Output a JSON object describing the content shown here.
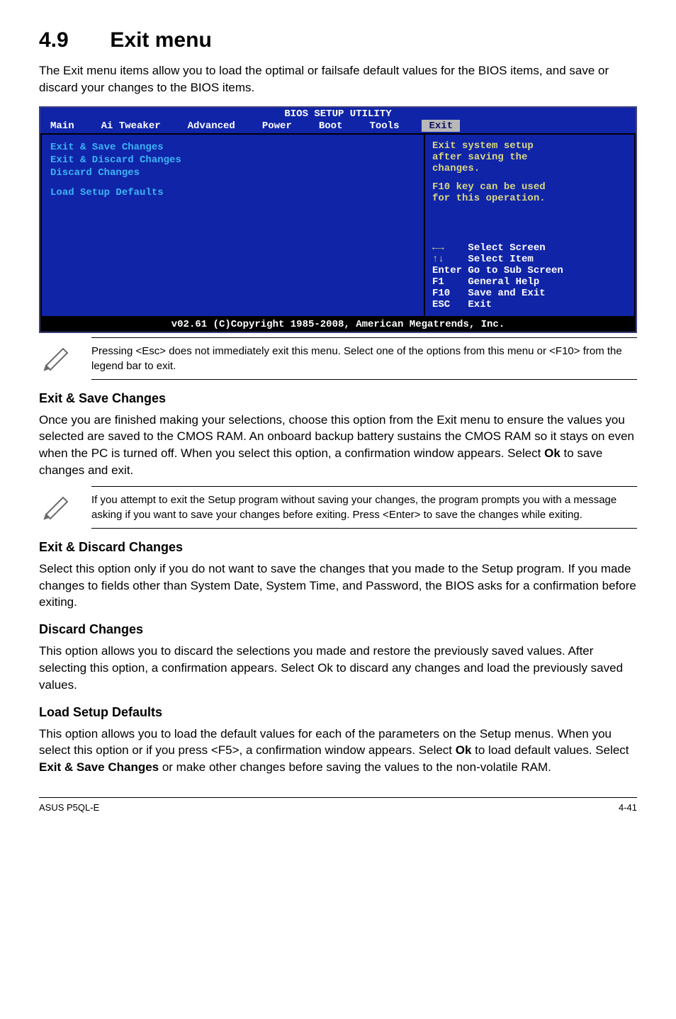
{
  "heading_num": "4.9",
  "heading_title": "Exit menu",
  "intro": "The Exit menu items allow you to load the optimal or failsafe default values for the BIOS items, and save or discard your changes to the BIOS items.",
  "bios": {
    "title": "BIOS SETUP UTILITY",
    "menu": {
      "main": "Main",
      "ai": "Ai Tweaker",
      "advanced": "Advanced",
      "power": "Power",
      "boot": "Boot",
      "tools": "Tools",
      "exit": "Exit"
    },
    "left": {
      "i0": "Exit & Save Changes",
      "i1": "Exit & Discard Changes",
      "i2": "Discard Changes",
      "i3": "Load Setup Defaults"
    },
    "help": {
      "l0": "Exit system setup",
      "l1": "after saving the",
      "l2": "changes.",
      "l3": "F10 key can be used",
      "l4": "for this operation."
    },
    "keys": {
      "k0": "      Select Screen",
      "k1": "      Select Item",
      "k2": "Enter Go to Sub Screen",
      "k3": "F1    General Help",
      "k4": "F10   Save and Exit",
      "k5": "ESC   Exit"
    },
    "footer": "v02.61 (C)Copyright 1985-2008, American Megatrends, Inc."
  },
  "note1": "Pressing <Esc> does not immediately exit this menu. Select one of the options from this menu or <F10> from the legend bar to exit.",
  "sec1_h": "Exit & Save Changes",
  "sec1_b1": "Once you are finished making your selections, choose this option from the Exit menu to ensure the values you selected are saved to the CMOS RAM. An onboard backup battery sustains the CMOS RAM so it stays on even when the PC is turned off. When you select this option, a confirmation window appears. Select ",
  "sec1_b2": "Ok",
  "sec1_b3": " to save changes and exit.",
  "note2": "If you attempt to exit the Setup program without saving your changes, the program prompts you with a message asking if you want to save your changes before exiting. Press <Enter> to save the changes while exiting.",
  "sec2_h": "Exit & Discard Changes",
  "sec2_b": "Select this option only if you do not want to save the changes that you  made to the Setup program. If you made changes to fields other than System Date, System Time, and Password, the BIOS asks for a confirmation before exiting.",
  "sec3_h": "Discard Changes",
  "sec3_b": "This option allows you to discard the selections you made and restore the previously saved values. After selecting this option, a confirmation appears. Select Ok to discard any changes and load the previously saved values.",
  "sec4_h": "Load Setup Defaults",
  "sec4_b1": "This option allows you to load the default values for each of the parameters on the Setup menus. When you select this option or if you press <F5>, a confirmation window appears. Select ",
  "sec4_b2": "Ok",
  "sec4_b3": " to load default values. Select ",
  "sec4_b4": "Exit & Save Changes",
  "sec4_b5": " or make other changes before saving the values to the non-volatile RAM.",
  "footer_left": "ASUS P5QL-E",
  "footer_right": "4-41",
  "chart_data": {
    "type": "table",
    "title": "BIOS Exit menu options and help panel",
    "menu_tabs": [
      "Main",
      "Ai Tweaker",
      "Advanced",
      "Power",
      "Boot",
      "Tools",
      "Exit"
    ],
    "left_panel_items": [
      "Exit & Save Changes",
      "Exit & Discard Changes",
      "Discard Changes",
      "Load Setup Defaults"
    ],
    "right_panel_help": [
      "Exit system setup after saving the changes.",
      "F10 key can be used for this operation."
    ],
    "legend": [
      {
        "key": "←→",
        "action": "Select Screen"
      },
      {
        "key": "↑↓",
        "action": "Select Item"
      },
      {
        "key": "Enter",
        "action": "Go to Sub Screen"
      },
      {
        "key": "F1",
        "action": "General Help"
      },
      {
        "key": "F10",
        "action": "Save and Exit"
      },
      {
        "key": "ESC",
        "action": "Exit"
      }
    ],
    "copyright": "v02.61 (C)Copyright 1985-2008, American Megatrends, Inc."
  }
}
